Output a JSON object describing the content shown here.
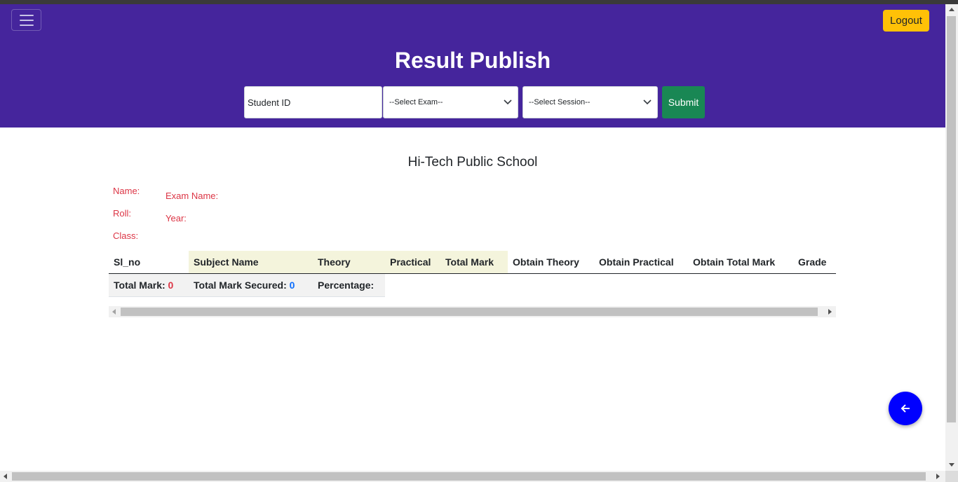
{
  "header": {
    "title": "Result Publish",
    "logout_label": "Logout",
    "menu_icon": "hamburger-icon",
    "bg_color": "#45259c"
  },
  "search": {
    "student_id_placeholder": "Student ID",
    "exam_select_value": "--Select Exam--",
    "session_select_value": "--Select Session--",
    "submit_label": "Submit"
  },
  "school": {
    "name": "Hi-Tech Public School"
  },
  "info": {
    "name_label": "Name:",
    "roll_label": "Roll:",
    "class_label": "Class:",
    "exam_name_label": "Exam Name:",
    "year_label": "Year:"
  },
  "table": {
    "columns": [
      "Sl_no",
      "Subject Name",
      "Theory",
      "Practical",
      "Total Mark",
      "Obtain Theory",
      "Obtain Practical",
      "Obtain Total Mark",
      "Grade"
    ],
    "summary": {
      "total_mark_label": "Total Mark:",
      "total_mark_value": "0",
      "secured_label": "Total Mark Secured:",
      "secured_value": "0",
      "percentage_label": "Percentage:"
    }
  },
  "fab": {
    "icon": "arrow-left-icon"
  }
}
